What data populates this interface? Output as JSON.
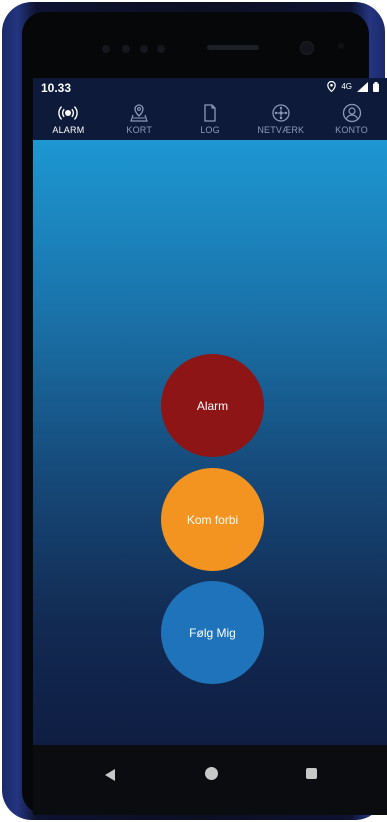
{
  "status_bar": {
    "time": "10.33",
    "network": "4G",
    "icons": [
      "location-pin-icon",
      "signal-icon",
      "battery-icon"
    ]
  },
  "nav": [
    {
      "label": "ALARM",
      "icon": "alarm-broadcast-icon",
      "active": true
    },
    {
      "label": "KORT",
      "icon": "map-pin-icon",
      "active": false
    },
    {
      "label": "LOG",
      "icon": "document-icon",
      "active": false
    },
    {
      "label": "NETVÆRK",
      "icon": "network-icon",
      "active": false
    },
    {
      "label": "KONTO",
      "icon": "account-icon",
      "active": false
    }
  ],
  "buttons": {
    "alarm": "Alarm",
    "kom_forbi": "Kom forbi",
    "folg_mig": "Følg Mig"
  },
  "colors": {
    "alarm": "#8d1515",
    "kom_forbi": "#f39320",
    "folg_mig": "#1f73ba",
    "header": "#0e1a3a"
  }
}
